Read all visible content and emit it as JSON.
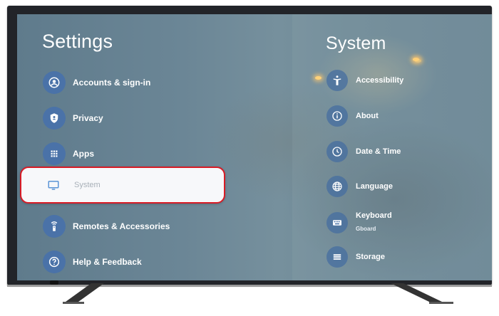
{
  "settings": {
    "title": "Settings",
    "items": [
      {
        "label": "Accounts & sign-in",
        "icon": "account-icon"
      },
      {
        "label": "Privacy",
        "icon": "shield-icon"
      },
      {
        "label": "Apps",
        "icon": "apps-grid-icon"
      },
      {
        "label": "System",
        "icon": "tv-icon",
        "selected": true
      },
      {
        "label": "Remotes & Accessories",
        "icon": "remote-icon"
      },
      {
        "label": "Help & Feedback",
        "icon": "help-icon"
      }
    ]
  },
  "system": {
    "title": "System",
    "items": [
      {
        "label": "Accessibility",
        "icon": "accessibility-icon"
      },
      {
        "label": "About",
        "icon": "info-icon"
      },
      {
        "label": "Date & Time",
        "icon": "clock-icon"
      },
      {
        "label": "Language",
        "icon": "globe-icon"
      },
      {
        "label": "Keyboard",
        "sublabel": "Gboard",
        "icon": "keyboard-icon"
      },
      {
        "label": "Storage",
        "icon": "storage-icon"
      }
    ]
  },
  "colors": {
    "selection_border": "#d81b25",
    "icon_circle": "#4a72a8"
  }
}
